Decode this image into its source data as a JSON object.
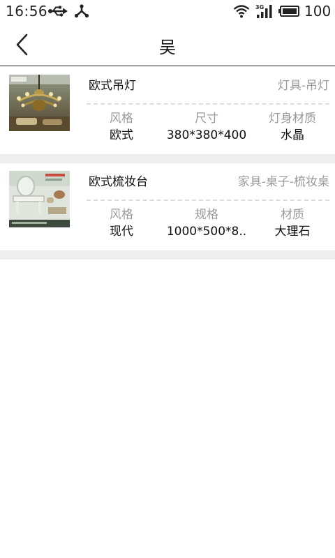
{
  "status_bar": {
    "time": "16:56",
    "battery": "100",
    "network": "3G"
  },
  "header": {
    "title": "吴"
  },
  "products": [
    {
      "name": "欧式吊灯",
      "category": "灯具-吊灯",
      "attributes": [
        {
          "label": "风格",
          "value": "欧式"
        },
        {
          "label": "尺寸",
          "value": "380*380*400"
        },
        {
          "label": "灯身材质",
          "value": "水晶"
        }
      ]
    },
    {
      "name": "欧式梳妆台",
      "category": "家具-桌子-梳妆桌",
      "attributes": [
        {
          "label": "风格",
          "value": "现代"
        },
        {
          "label": "规格",
          "value": "1000*500*8.."
        },
        {
          "label": "材质",
          "value": "大理石"
        }
      ]
    }
  ],
  "colors": {
    "divider": "#eeeeee",
    "muted_text": "#9a9a9a",
    "primary_text": "#111111"
  }
}
